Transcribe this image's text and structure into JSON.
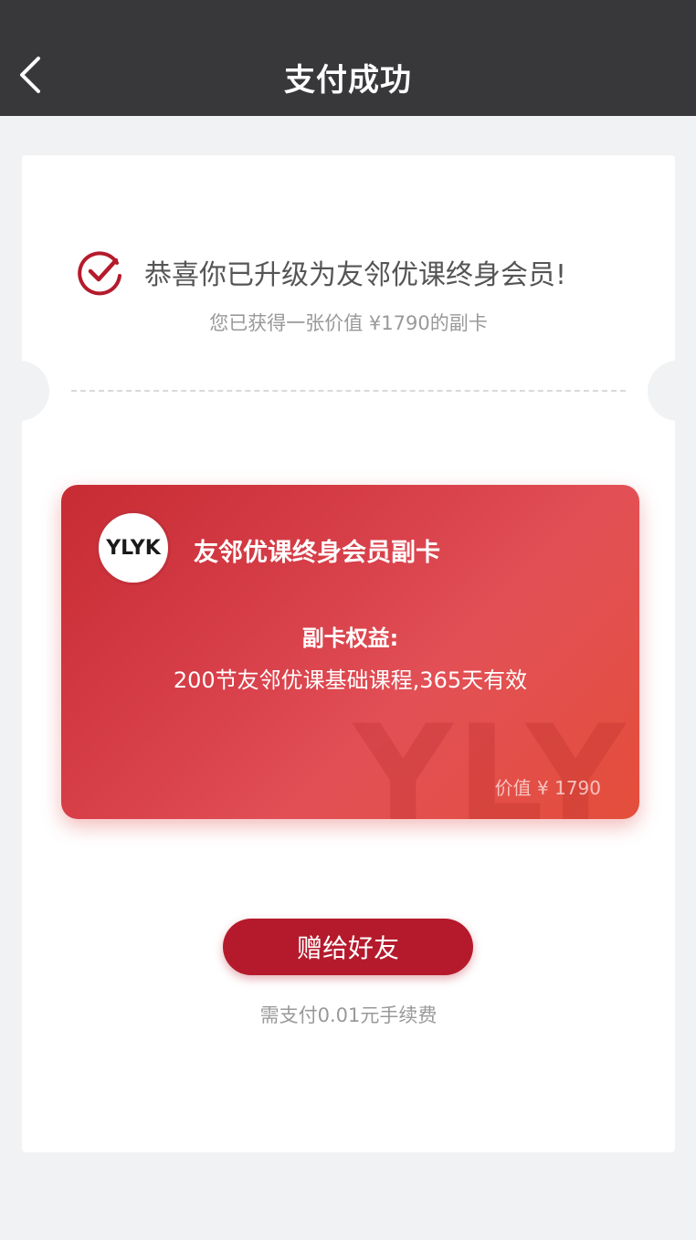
{
  "navbar": {
    "title": "支付成功",
    "back_icon": "chevron-left-icon"
  },
  "success": {
    "icon": "check-circle-icon",
    "title": "恭喜你已升级为友邻优课终身会员!",
    "subtitle": "您已获得一张价值 ¥1790的副卡"
  },
  "card": {
    "logo_text": "YLYK",
    "title": "友邻优课终身会员副卡",
    "benefit_label": "副卡权益:",
    "benefit_desc": "200节友邻优课基础课程,365天有效",
    "value_text": "价值 ¥ 1790",
    "watermark": "YLYK"
  },
  "actions": {
    "gift_button_label": "赠给好友",
    "fee_note": "需支付0.01元手续费"
  },
  "colors": {
    "navbar_bg": "#38383b",
    "accent_red": "#b51a2c",
    "card_red": "#d8404a"
  }
}
